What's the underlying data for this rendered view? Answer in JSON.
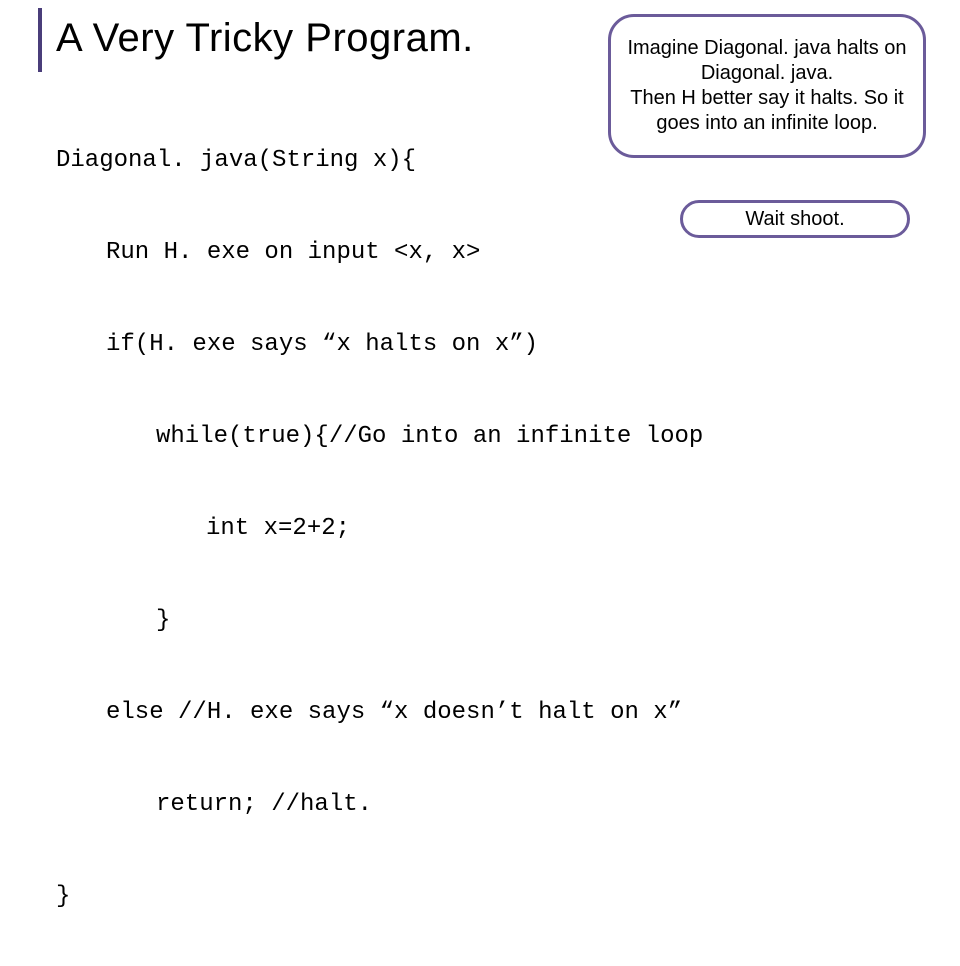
{
  "title": "A Very Tricky Program.",
  "code": {
    "l1": "Diagonal. java(String x){",
    "l2": "Run H. exe on input <x, x>",
    "l3": "if(H. exe says “x halts on x”)",
    "l4": "while(true){//Go into an infinite loop",
    "l5": "int x=2+2;",
    "l6": "}",
    "l7": "else //H. exe says “x doesn’t halt on x”",
    "l8": "return; //halt.",
    "l9": "}"
  },
  "callout1": "Imagine Diagonal. java halts on Diagonal. java.\nThen H better say it halts. So it goes into an infinite loop.",
  "callout2": "Wait shoot."
}
